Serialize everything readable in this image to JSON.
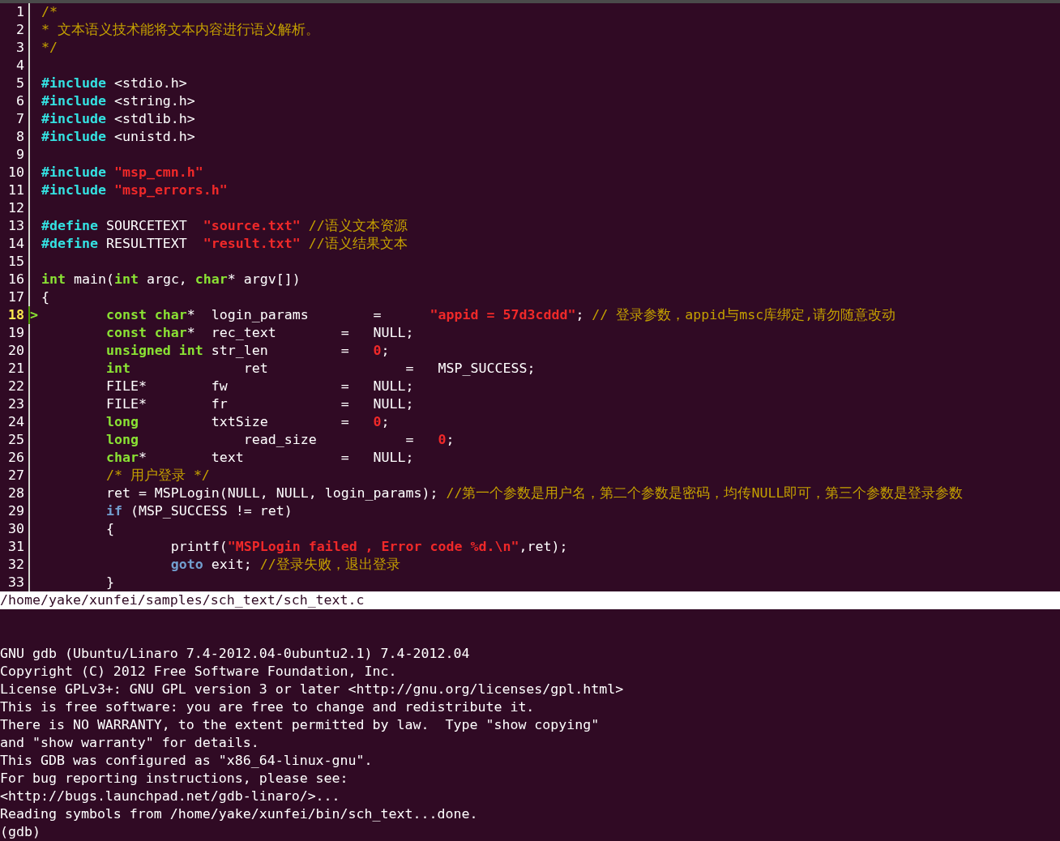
{
  "editor": {
    "lines": [
      {
        "number": "1",
        "current": false,
        "tokens": [
          {
            "kind": "comment",
            "text": "/*"
          }
        ]
      },
      {
        "number": "2",
        "current": false,
        "tokens": [
          {
            "kind": "comment",
            "text": "* 文本语义技术能将文本内容进行语义解析。"
          }
        ]
      },
      {
        "number": "3",
        "current": false,
        "tokens": [
          {
            "kind": "comment",
            "text": "*/"
          }
        ]
      },
      {
        "number": "4",
        "current": false
      },
      {
        "number": "5",
        "current": false,
        "tokens": [
          {
            "kind": "preproc",
            "text": "#include"
          },
          {
            "kind": "plain",
            "text": " <stdio.h>"
          }
        ]
      },
      {
        "number": "6",
        "current": false,
        "tokens": [
          {
            "kind": "preproc",
            "text": "#include"
          },
          {
            "kind": "plain",
            "text": " <string.h>"
          }
        ]
      },
      {
        "number": "7",
        "current": false,
        "tokens": [
          {
            "kind": "preproc",
            "text": "#include"
          },
          {
            "kind": "plain",
            "text": " <stdlib.h>"
          }
        ]
      },
      {
        "number": "8",
        "current": false,
        "tokens": [
          {
            "kind": "preproc",
            "text": "#include"
          },
          {
            "kind": "plain",
            "text": " <unistd.h>"
          }
        ]
      },
      {
        "number": "9",
        "current": false
      },
      {
        "number": "10",
        "current": false,
        "tokens": [
          {
            "kind": "preproc",
            "text": "#include"
          },
          {
            "kind": "string",
            "text": " \"msp_cmn.h\""
          }
        ]
      },
      {
        "number": "11",
        "current": false,
        "tokens": [
          {
            "kind": "preproc",
            "text": "#include"
          },
          {
            "kind": "string",
            "text": " \"msp_errors.h\""
          }
        ]
      },
      {
        "number": "12",
        "current": false
      },
      {
        "number": "13",
        "current": false,
        "tokens": [
          {
            "kind": "preproc",
            "text": "#define"
          },
          {
            "kind": "plain",
            "text": " SOURCETEXT  "
          },
          {
            "kind": "string",
            "text": "\"source.txt\""
          },
          {
            "kind": "comment",
            "text": " //语义文本资源"
          }
        ]
      },
      {
        "number": "14",
        "current": false,
        "tokens": [
          {
            "kind": "preproc",
            "text": "#define"
          },
          {
            "kind": "plain",
            "text": " RESULTTEXT  "
          },
          {
            "kind": "string",
            "text": "\"result.txt\""
          },
          {
            "kind": "comment",
            "text": " //语义结果文本"
          }
        ]
      },
      {
        "number": "15",
        "current": false
      },
      {
        "number": "16",
        "current": false,
        "tokens": [
          {
            "kind": "type",
            "text": "int"
          },
          {
            "kind": "plain",
            "text": " main("
          },
          {
            "kind": "type",
            "text": "int"
          },
          {
            "kind": "plain",
            "text": " argc, "
          },
          {
            "kind": "type",
            "text": "char"
          },
          {
            "kind": "plain",
            "text": "* argv[])"
          }
        ]
      },
      {
        "number": "17",
        "current": false,
        "tokens": [
          {
            "kind": "plain",
            "text": "{"
          }
        ]
      },
      {
        "number": "18",
        "current": true,
        "marker": ">",
        "tokens": [
          {
            "kind": "type",
            "text": "        const char"
          },
          {
            "kind": "plain",
            "text": "*  login_params        =      "
          },
          {
            "kind": "string",
            "text": "\"appid = 57d3cddd\""
          },
          {
            "kind": "plain",
            "text": "; "
          },
          {
            "kind": "comment",
            "text": "// 登录参数，appid与msc库绑定,请勿随意改动"
          }
        ]
      },
      {
        "number": "19",
        "current": false,
        "tokens": [
          {
            "kind": "type",
            "text": "        const char"
          },
          {
            "kind": "plain",
            "text": "*  rec_text        =   NULL;"
          }
        ]
      },
      {
        "number": "20",
        "current": false,
        "tokens": [
          {
            "kind": "type",
            "text": "        unsigned int"
          },
          {
            "kind": "plain",
            "text": " str_len         =   "
          },
          {
            "kind": "string",
            "text": "0"
          },
          {
            "kind": "plain",
            "text": ";"
          }
        ]
      },
      {
        "number": "21",
        "current": false,
        "tokens": [
          {
            "kind": "type",
            "text": "        int"
          },
          {
            "kind": "plain",
            "text": "              ret                 =   MSP_SUCCESS;"
          }
        ]
      },
      {
        "number": "22",
        "current": false,
        "tokens": [
          {
            "kind": "plain",
            "text": "        FILE*        fw              =   NULL;"
          }
        ]
      },
      {
        "number": "23",
        "current": false,
        "tokens": [
          {
            "kind": "plain",
            "text": "        FILE*        fr              =   NULL;"
          }
        ]
      },
      {
        "number": "24",
        "current": false,
        "tokens": [
          {
            "kind": "type",
            "text": "        long"
          },
          {
            "kind": "plain",
            "text": "         txtSize         =   "
          },
          {
            "kind": "string",
            "text": "0"
          },
          {
            "kind": "plain",
            "text": ";"
          }
        ]
      },
      {
        "number": "25",
        "current": false,
        "tokens": [
          {
            "kind": "type",
            "text": "        long"
          },
          {
            "kind": "plain",
            "text": "             read_size           =   "
          },
          {
            "kind": "string",
            "text": "0"
          },
          {
            "kind": "plain",
            "text": ";"
          }
        ]
      },
      {
        "number": "26",
        "current": false,
        "tokens": [
          {
            "kind": "type",
            "text": "        char"
          },
          {
            "kind": "plain",
            "text": "*        text            =   NULL;"
          }
        ]
      },
      {
        "number": "27",
        "current": false,
        "tokens": [
          {
            "kind": "comment",
            "text": "        /* 用户登录 */"
          }
        ]
      },
      {
        "number": "28",
        "current": false,
        "tokens": [
          {
            "kind": "plain",
            "text": "        ret = MSPLogin(NULL, NULL, login_params); "
          },
          {
            "kind": "comment",
            "text": "//第一个参数是用户名，第二个参数是密码，均传NULL即可，第三个参数是登录参数"
          }
        ]
      },
      {
        "number": "29",
        "current": false,
        "tokens": [
          {
            "kind": "keyword",
            "text": "        if"
          },
          {
            "kind": "plain",
            "text": " (MSP_SUCCESS != ret)"
          }
        ]
      },
      {
        "number": "30",
        "current": false,
        "tokens": [
          {
            "kind": "plain",
            "text": "        {"
          }
        ]
      },
      {
        "number": "31",
        "current": false,
        "tokens": [
          {
            "kind": "plain",
            "text": "                printf("
          },
          {
            "kind": "string",
            "text": "\"MSPLogin failed , Error code %d.\\n\""
          },
          {
            "kind": "plain",
            "text": ",ret);"
          }
        ]
      },
      {
        "number": "32",
        "current": false,
        "tokens": [
          {
            "kind": "keyword",
            "text": "                goto"
          },
          {
            "kind": "plain",
            "text": " exit; "
          },
          {
            "kind": "comment",
            "text": "//登录失败，退出登录"
          }
        ]
      },
      {
        "number": "33",
        "current": false,
        "tokens": [
          {
            "kind": "plain",
            "text": "        }"
          }
        ]
      }
    ]
  },
  "status_bar": {
    "file_path": "/home/yake/xunfei/samples/sch_text/sch_text.c"
  },
  "console": {
    "lines": [
      "GNU gdb (Ubuntu/Linaro 7.4-2012.04-0ubuntu2.1) 7.4-2012.04",
      "Copyright (C) 2012 Free Software Foundation, Inc.",
      "License GPLv3+: GNU GPL version 3 or later <http://gnu.org/licenses/gpl.html>",
      "This is free software: you are free to change and redistribute it.",
      "There is NO WARRANTY, to the extent permitted by law.  Type \"show copying\"",
      "and \"show warranty\" for details.",
      "This GDB was configured as \"x86_64-linux-gnu\".",
      "For bug reporting instructions, please see:",
      "<http://bugs.launchpad.net/gdb-linaro/>...",
      "Reading symbols from /home/yake/xunfei/bin/sch_text...done.",
      "(gdb)"
    ]
  }
}
